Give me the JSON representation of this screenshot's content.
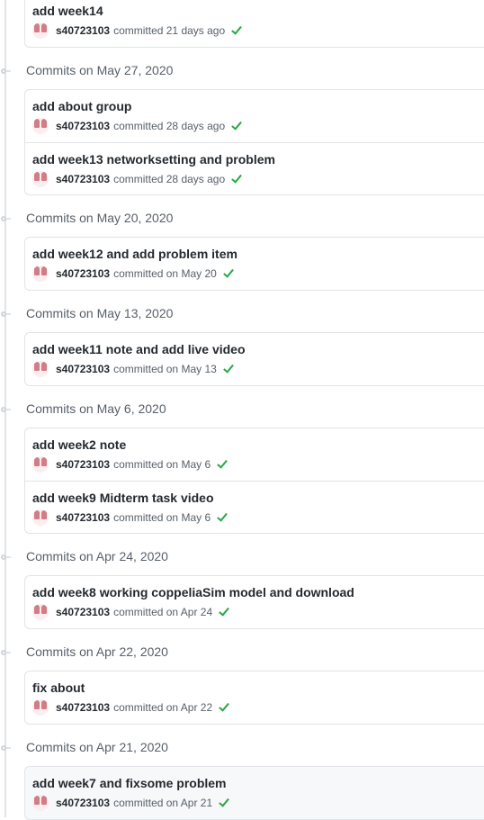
{
  "groups": [
    {
      "title": "",
      "commits": [
        {
          "message": "add week14",
          "author": "s40723103",
          "when": "committed 21 days ago"
        }
      ]
    },
    {
      "title": "Commits on May 27, 2020",
      "commits": [
        {
          "message": "add about group",
          "author": "s40723103",
          "when": "committed 28 days ago"
        },
        {
          "message": "add week13 networksetting and problem",
          "author": "s40723103",
          "when": "committed 28 days ago"
        }
      ]
    },
    {
      "title": "Commits on May 20, 2020",
      "commits": [
        {
          "message": "add week12 and add problem item",
          "author": "s40723103",
          "when": "committed on May 20"
        }
      ]
    },
    {
      "title": "Commits on May 13, 2020",
      "commits": [
        {
          "message": "add week11 note and add live video",
          "author": "s40723103",
          "when": "committed on May 13"
        }
      ]
    },
    {
      "title": "Commits on May 6, 2020",
      "commits": [
        {
          "message": "add week2 note",
          "author": "s40723103",
          "when": "committed on May 6"
        },
        {
          "message": "add week9 Midterm task video",
          "author": "s40723103",
          "when": "committed on May 6"
        }
      ]
    },
    {
      "title": "Commits on Apr 24, 2020",
      "commits": [
        {
          "message": "add week8 working coppeliaSim model and download",
          "author": "s40723103",
          "when": "committed on Apr 24"
        }
      ]
    },
    {
      "title": "Commits on Apr 22, 2020",
      "commits": [
        {
          "message": "fix about",
          "author": "s40723103",
          "when": "committed on Apr 22"
        }
      ]
    },
    {
      "title": "Commits on Apr 21, 2020",
      "commits": [
        {
          "message": "add week7 and fixsome problem",
          "author": "s40723103",
          "when": "committed on Apr 21"
        }
      ]
    }
  ],
  "colors": {
    "success_check": "#28a745",
    "border": "#e1e4e8",
    "muted_text": "#586069"
  }
}
